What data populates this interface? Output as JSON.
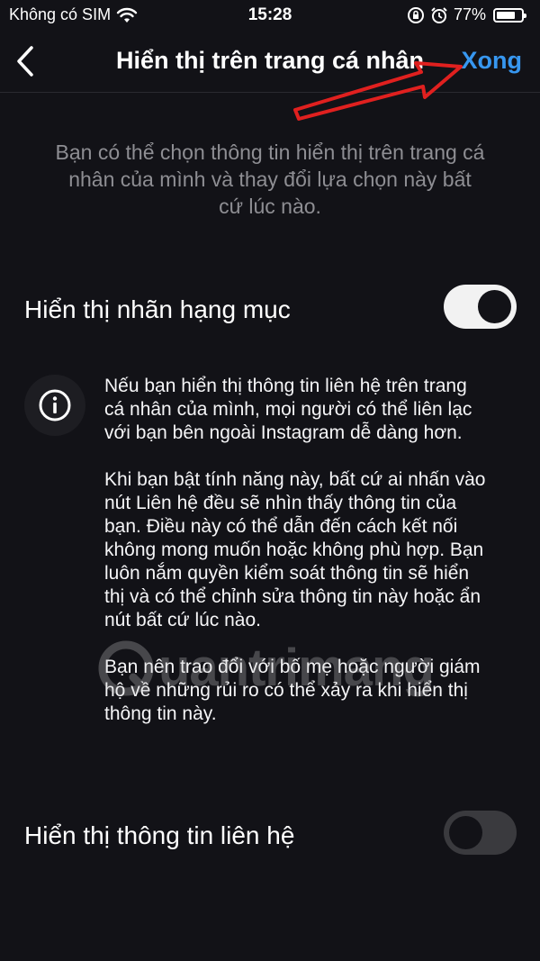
{
  "status_bar": {
    "carrier": "Không có SIM",
    "time": "15:28",
    "battery_percent": "77%",
    "battery_level": 0.77,
    "icons": [
      "wifi-icon",
      "orientation-lock-icon",
      "alarm-icon",
      "battery-icon"
    ]
  },
  "header": {
    "title": "Hiển thị trên trang cá nhân",
    "done_label": "Xong"
  },
  "description": "Bạn có thể chọn thông tin hiển thị trên trang cá nhân của mình và thay đổi lựa chọn này bất cứ lúc nào.",
  "toggles": [
    {
      "label": "Hiển thị nhãn hạng mục",
      "on": true
    },
    {
      "label": "Hiển thị thông tin liên hệ",
      "on": false
    }
  ],
  "info": {
    "icon": "info-icon",
    "paragraphs": [
      "Nếu bạn hiển thị thông tin liên hệ trên trang cá nhân của mình, mọi người có thể liên lạc với bạn bên ngoài Instagram dễ dàng hơn.",
      "Khi bạn bật tính năng này, bất cứ ai nhấn vào nút Liên hệ đều sẽ nhìn thấy thông tin của bạn. Điều này có thể dẫn đến cách kết nối không mong muốn hoặc không phù hợp. Bạn luôn nắm quyền kiểm soát thông tin sẽ hiển thị và có thể chỉnh sửa thông tin này hoặc ẩn nút bất cứ lúc nào.",
      "Bạn nên trao đổi với bố mẹ hoặc người giám hộ về những rủi ro có thể xảy ra khi hiển thị thông tin này."
    ]
  },
  "watermark": "uantrimang",
  "colors": {
    "background": "#121217",
    "accent": "#3797f0",
    "annotation_arrow": "#e0201f"
  }
}
